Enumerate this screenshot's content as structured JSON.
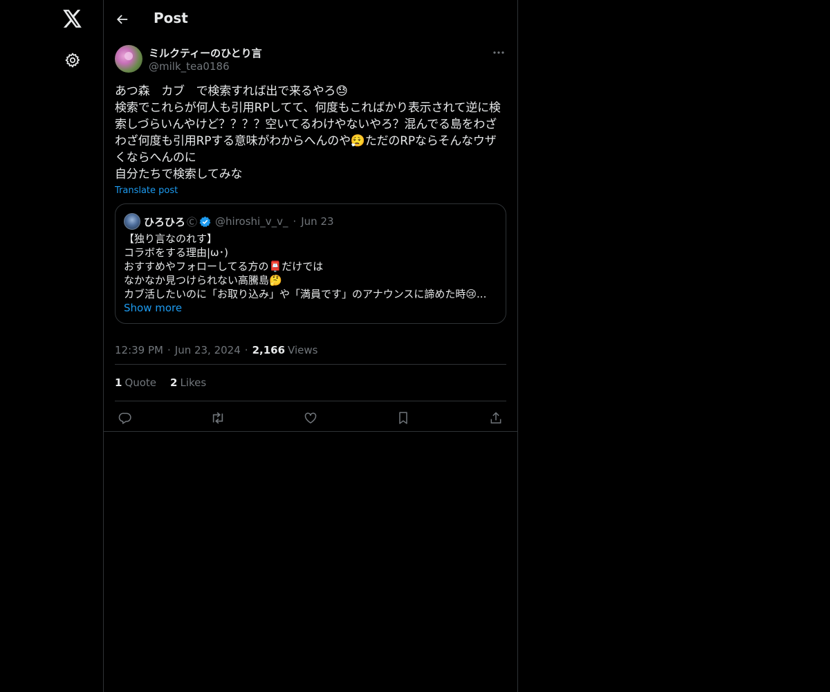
{
  "nav": {
    "logo_icon": "x-logo-icon",
    "settings_icon": "gear-icon"
  },
  "header": {
    "back_icon": "arrow-left-icon",
    "title": "Post"
  },
  "post": {
    "author": {
      "display_name": "ミルクティーのひとり言",
      "handle": "@milk_tea0186"
    },
    "text": "あつ森　カブ　で検索すれば出で来るやろ😓\n検索でこれらが何人も引用RPしてて、何度もこればかり表示されて逆に検索しづらいんやけど？？？？空いてるわけやないやろ？混んでる島をわざわざ何度も引用RPする意味がわからへんのや😮‍💨ただのRPならそんなウザくならへんのに\n自分たちで検索してみな",
    "translate_label": "Translate post",
    "quoted": {
      "display_name": "ひろひろ",
      "copyright_mark": "Ⓒ",
      "handle": "@hiroshi_v_v_",
      "date": "Jun 23",
      "text": "【独り言なのれす】\nコラボをする理由|ω･)\nおすすめやフォローしてる方の📮だけでは\nなかなか見つけられない高騰島🤔\nカブ活したいのに「お取り込み」や「満員です」のアナウンスに諦めた時😢...",
      "show_more_label": "Show more"
    },
    "time": "12:39 PM",
    "date": "Jun 23, 2024",
    "views_count": "2,166",
    "views_label": "Views",
    "stats": {
      "quotes_count": "1",
      "quotes_label": "Quote",
      "likes_count": "2",
      "likes_label": "Likes"
    },
    "actions": [
      "reply-icon",
      "repost-icon",
      "like-icon",
      "bookmark-icon",
      "share-icon"
    ]
  },
  "colors": {
    "background": "#000000",
    "text": "#e7e9ea",
    "secondary_text": "#71767b",
    "accent": "#1d9bf0",
    "border": "#2f3336"
  }
}
